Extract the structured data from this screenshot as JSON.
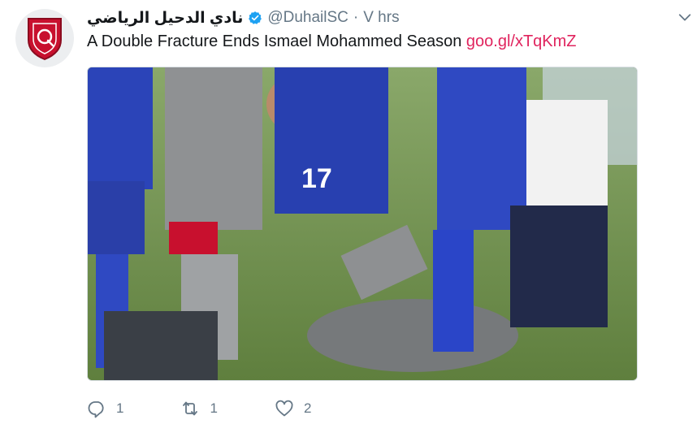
{
  "author": {
    "display_name": "نادي الدحيل الرياضي",
    "handle": "@DuhailSC",
    "separator": "·",
    "time": "V hrs",
    "verified": true
  },
  "tweet": {
    "text": "A Double Fracture Ends Ismael Mohammed Season",
    "link": "goo.gl/xTqKmZ"
  },
  "media": {
    "description_icon": "photo",
    "jersey_number": "17"
  },
  "actions": {
    "reply_count": "1",
    "retweet_count": "1",
    "like_count": "2"
  },
  "colors": {
    "link": "#e0245e",
    "muted": "#657786",
    "verified": "#1da1f2",
    "club_red": "#c8102e"
  },
  "icons": {
    "verified": "verified-badge-icon",
    "caret": "chevron-down-icon",
    "reply": "reply-icon",
    "retweet": "retweet-icon",
    "like": "heart-icon"
  }
}
